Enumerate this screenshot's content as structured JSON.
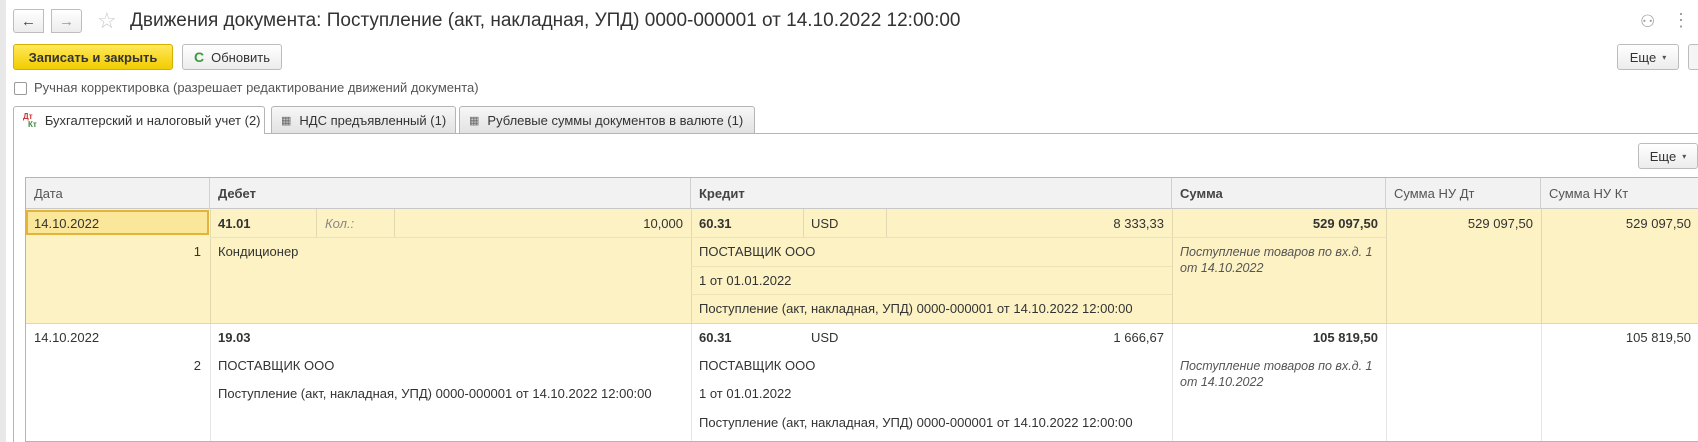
{
  "header": {
    "title": "Движения документа: Поступление (акт, накладная, УПД) 0000-000001 от 14.10.2022 12:00:00",
    "back_icon": "←",
    "forward_icon": "→",
    "star_icon": "☆",
    "link_icon": "⚇",
    "menu_icon": "⋮"
  },
  "toolbar": {
    "save_close_label": "Записать и закрыть",
    "refresh_label": "Обновить",
    "refresh_icon": "C",
    "more_label": "Еще",
    "caret": "▾"
  },
  "manual_edit": {
    "label": "Ручная корректировка (разрешает редактирование движений документа)",
    "checked": false
  },
  "tabs": [
    {
      "label": "Бухгалтерский и налоговый учет (2)",
      "icon_top": "Дт",
      "icon_bottom": "Кт",
      "active": true
    },
    {
      "label": "НДС предъявленный (1)",
      "icon": "▦",
      "active": false
    },
    {
      "label": "Рублевые суммы документов в валюте (1)",
      "icon": "▦",
      "active": false
    }
  ],
  "table": {
    "more_label": "Еще",
    "columns": {
      "date": "Дата",
      "debit": "Дебет",
      "credit": "Кредит",
      "sum": "Сумма",
      "sum_nu_dt": "Сумма НУ Дт",
      "sum_nu_kt": "Сумма НУ Кт"
    },
    "rows": [
      {
        "date": "14.10.2022",
        "num": "1",
        "debit_account": "41.01",
        "debit_qty_label": "Кол.:",
        "debit_qty": "10,000",
        "debit_sub1": "Кондиционер",
        "credit_account": "60.31",
        "credit_currency": "USD",
        "credit_currency_sum": "8 333,33",
        "credit_sub1": "ПОСТАВЩИК ООО",
        "credit_sub2": "1 от 01.01.2022",
        "credit_sub3": "Поступление (акт, накладная, УПД) 0000-000001 от 14.10.2022 12:00:00",
        "sum": "529 097,50",
        "content": "Поступление товаров по вх.д. 1 от 14.10.2022",
        "sum_nu_dt": "529 097,50",
        "sum_nu_kt": "529 097,50"
      },
      {
        "date": "14.10.2022",
        "num": "2",
        "debit_account": "19.03",
        "debit_sub1": "ПОСТАВЩИК ООО",
        "debit_sub2": "Поступление (акт, накладная, УПД) 0000-000001 от 14.10.2022 12:00:00",
        "credit_account": "60.31",
        "credit_currency": "USD",
        "credit_currency_sum": "1 666,67",
        "credit_sub1": "ПОСТАВЩИК ООО",
        "credit_sub2": "1 от 01.01.2022",
        "credit_sub3": "Поступление (акт, накладная, УПД) 0000-000001 от 14.10.2022 12:00:00",
        "sum": "105 819,50",
        "content": "Поступление товаров по вх.д. 1 от 14.10.2022",
        "sum_nu_dt": "",
        "sum_nu_kt": "105 819,50"
      }
    ]
  },
  "colors": {
    "accent_yellow": "#f2cc00",
    "selected_row": "#fdf2c4",
    "selection_border": "#e3b43a"
  }
}
